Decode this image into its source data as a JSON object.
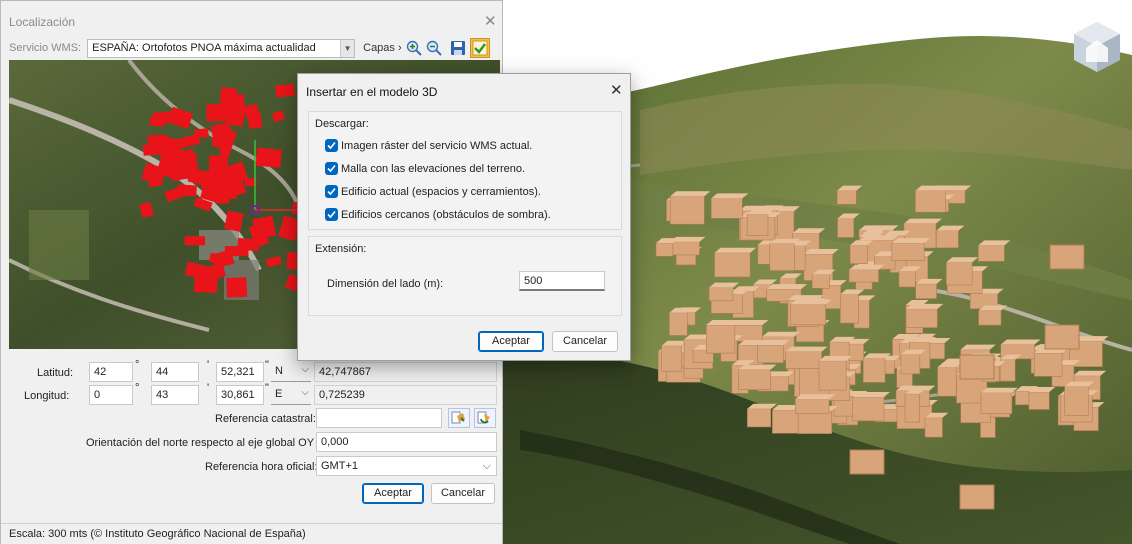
{
  "localization": {
    "title": "Localización",
    "wms_label": "Servicio WMS:",
    "wms_value": "ESPAÑA: Ortofotos PNOA máxima actualidad",
    "capas_label": "Capas",
    "latitude": {
      "label": "Latitud:",
      "deg": "42",
      "min": "44",
      "sec": "52,321",
      "hemi": "N",
      "decimal": "42,747867"
    },
    "longitude": {
      "label": "Longitud:",
      "deg": "0",
      "min": "43",
      "sec": "30,861",
      "hemi": "E",
      "decimal": "0,725239"
    },
    "symbols": {
      "deg": "°",
      "min": "'",
      "sec": "\""
    },
    "cadastral_label": "Referencia catastral:",
    "cadastral_value": "",
    "north_label": "Orientación del norte respecto al eje global OY (º):",
    "north_value": "0,000",
    "timezone_label": "Referencia hora oficial:",
    "timezone_value": "GMT+1",
    "accept": "Aceptar",
    "cancel": "Cancelar",
    "status": "Escala: 300 mts (© Instituto Geográfico Nacional de España)"
  },
  "insert_dialog": {
    "title": "Insertar en el modelo 3D",
    "download_group": "Descargar:",
    "options": [
      {
        "label": "Imagen ráster del servicio WMS actual.",
        "checked": true
      },
      {
        "label": "Malla con las elevaciones del terreno.",
        "checked": true
      },
      {
        "label": "Edificio actual (espacios y cerramientos).",
        "checked": true
      },
      {
        "label": "Edificios cercanos (obstáculos de sombra).",
        "checked": true
      }
    ],
    "extension_group": "Extensión:",
    "side_label": "Dimensión del lado (m):",
    "side_value": "500",
    "accept": "Aceptar",
    "cancel": "Cancelar"
  },
  "colors": {
    "accent": "#0067c0",
    "building_red": "#e8141a",
    "building_3d": "#d8a57a"
  },
  "icons": [
    "close-icon",
    "dropdown-icon",
    "zoom-in-icon",
    "zoom-out-icon",
    "save-icon",
    "check-icon",
    "cadastral-search-icon",
    "cadastral-sync-icon",
    "cube-view-icon"
  ]
}
